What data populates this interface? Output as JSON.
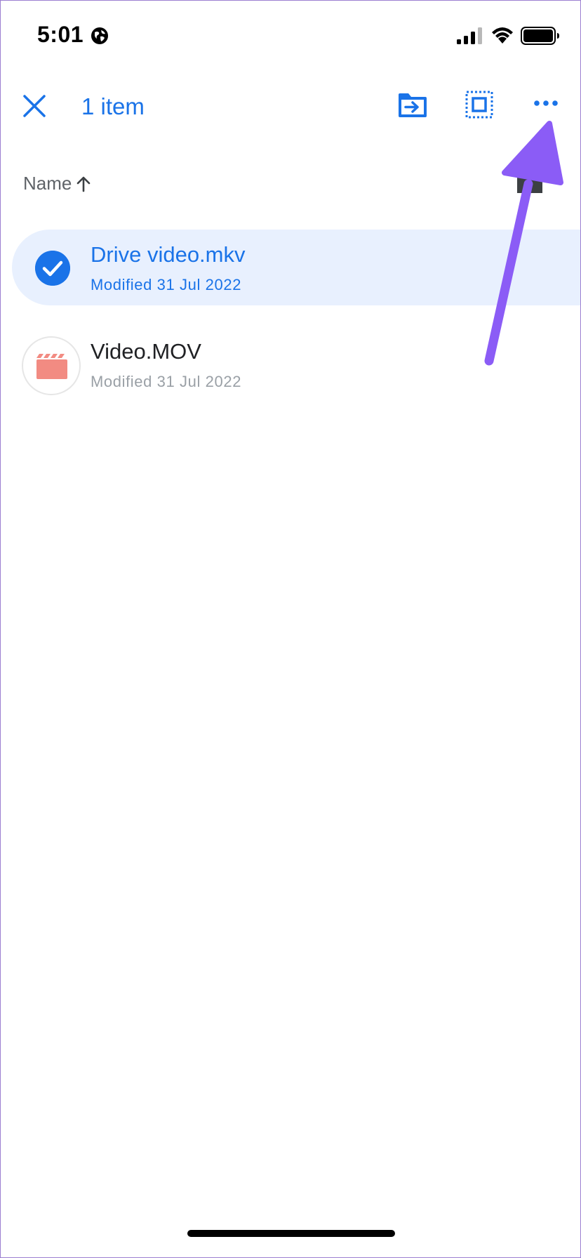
{
  "status_bar": {
    "time": "5:01",
    "icons": [
      "globe-icon",
      "signal-icon",
      "wifi-icon",
      "battery-icon"
    ]
  },
  "toolbar": {
    "selection_count": "1 item",
    "icons": [
      "close-icon",
      "move-to-folder-icon",
      "select-all-icon",
      "more-options-icon"
    ]
  },
  "sort": {
    "label": "Name",
    "direction_icon": "arrow-up-icon",
    "view_toggle_icon": "list-view-icon"
  },
  "files": [
    {
      "name": "Drive video.mkv",
      "meta": "Modified 31 Jul 2022",
      "selected": true,
      "icon": "check-circle-icon"
    },
    {
      "name": "Video.MOV",
      "meta": "Modified 31 Jul 2022",
      "selected": false,
      "icon": "video-clapper-icon"
    }
  ],
  "colors": {
    "accent": "#1a73e8",
    "selected_row_bg": "#e8f0fe",
    "annotation_arrow": "#8b5cf6",
    "video_icon": "#f28b82",
    "secondary_text": "#5f6368"
  }
}
